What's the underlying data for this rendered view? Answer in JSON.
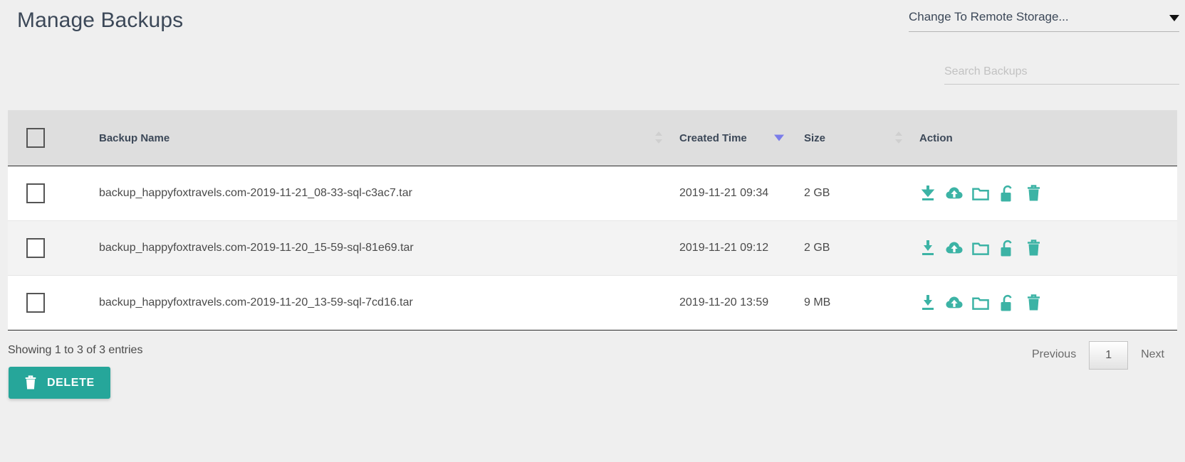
{
  "header": {
    "title": "Manage Backups",
    "remote_storage": {
      "label": "Change To Remote Storage...",
      "caret_icon": "chevron-down-icon"
    },
    "search": {
      "placeholder": "Search Backups",
      "value": ""
    }
  },
  "table": {
    "columns": {
      "select": "",
      "name": "Backup Name",
      "created": "Created Time",
      "size": "Size",
      "action": "Action"
    },
    "sort": {
      "column": "Created Time",
      "direction": "desc",
      "indicator_color": "#7b7dea"
    },
    "rows": [
      {
        "name": "backup_happyfoxtravels.com-2019-11-21_08-33-sql-c3ac7.tar",
        "created": "2019-11-21 09:34",
        "size": "2 GB"
      },
      {
        "name": "backup_happyfoxtravels.com-2019-11-20_15-59-sql-81e69.tar",
        "created": "2019-11-21 09:12",
        "size": "2 GB"
      },
      {
        "name": "backup_happyfoxtravels.com-2019-11-20_13-59-sql-7cd16.tar",
        "created": "2019-11-20 13:59",
        "size": "9 MB"
      }
    ],
    "row_actions": [
      "download-icon",
      "cloud-upload-icon",
      "folder-icon",
      "unlock-icon",
      "trash-icon"
    ],
    "action_icon_color": "#3cb3a5"
  },
  "footer": {
    "showing": "Showing 1 to 3 of 3 entries",
    "pagination": {
      "previous": "Previous",
      "current_page": "1",
      "next": "Next"
    },
    "delete_button": {
      "label": "DELETE",
      "icon": "trash-icon",
      "color": "#26a69a"
    }
  }
}
